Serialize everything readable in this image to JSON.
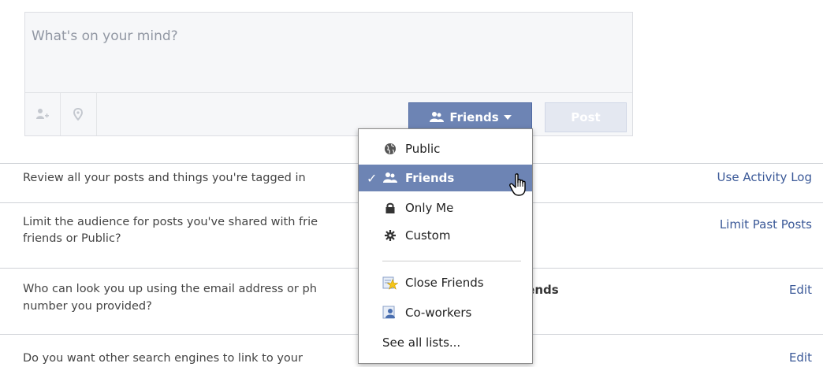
{
  "composer": {
    "placeholder": "What's on your mind?",
    "audience_label": "Friends",
    "post_label": "Post",
    "icons": [
      "tag-friend-icon",
      "location-pin-icon"
    ]
  },
  "rows": [
    {
      "text": "Review all your posts and things you're tagged in",
      "action": "Use Activity Log"
    },
    {
      "text_line1": "Limit the audience for posts you've shared with frie",
      "text_line2": "friends or Public?",
      "action": "Limit Past Posts"
    },
    {
      "text_line1": "Who can look you up using the email address or ph",
      "text_line2": "number you provided?",
      "value": "iends",
      "action": "Edit"
    },
    {
      "text": "Do you want other search engines to link to your",
      "action": "Edit"
    }
  ],
  "menu": {
    "items": [
      {
        "label": "Public",
        "icon": "globe-icon"
      },
      {
        "label": "Friends",
        "icon": "friends-icon",
        "selected": true
      },
      {
        "label": "Only Me",
        "icon": "lock-icon"
      },
      {
        "label": "Custom",
        "icon": "gear-icon"
      },
      {
        "label": "Close Friends",
        "icon": "star-list-icon"
      },
      {
        "label": "Co-workers",
        "icon": "coworkers-icon"
      }
    ],
    "see_all": "See all lists..."
  },
  "colors": {
    "accent": "#6d84b4",
    "link": "#3b5998"
  }
}
